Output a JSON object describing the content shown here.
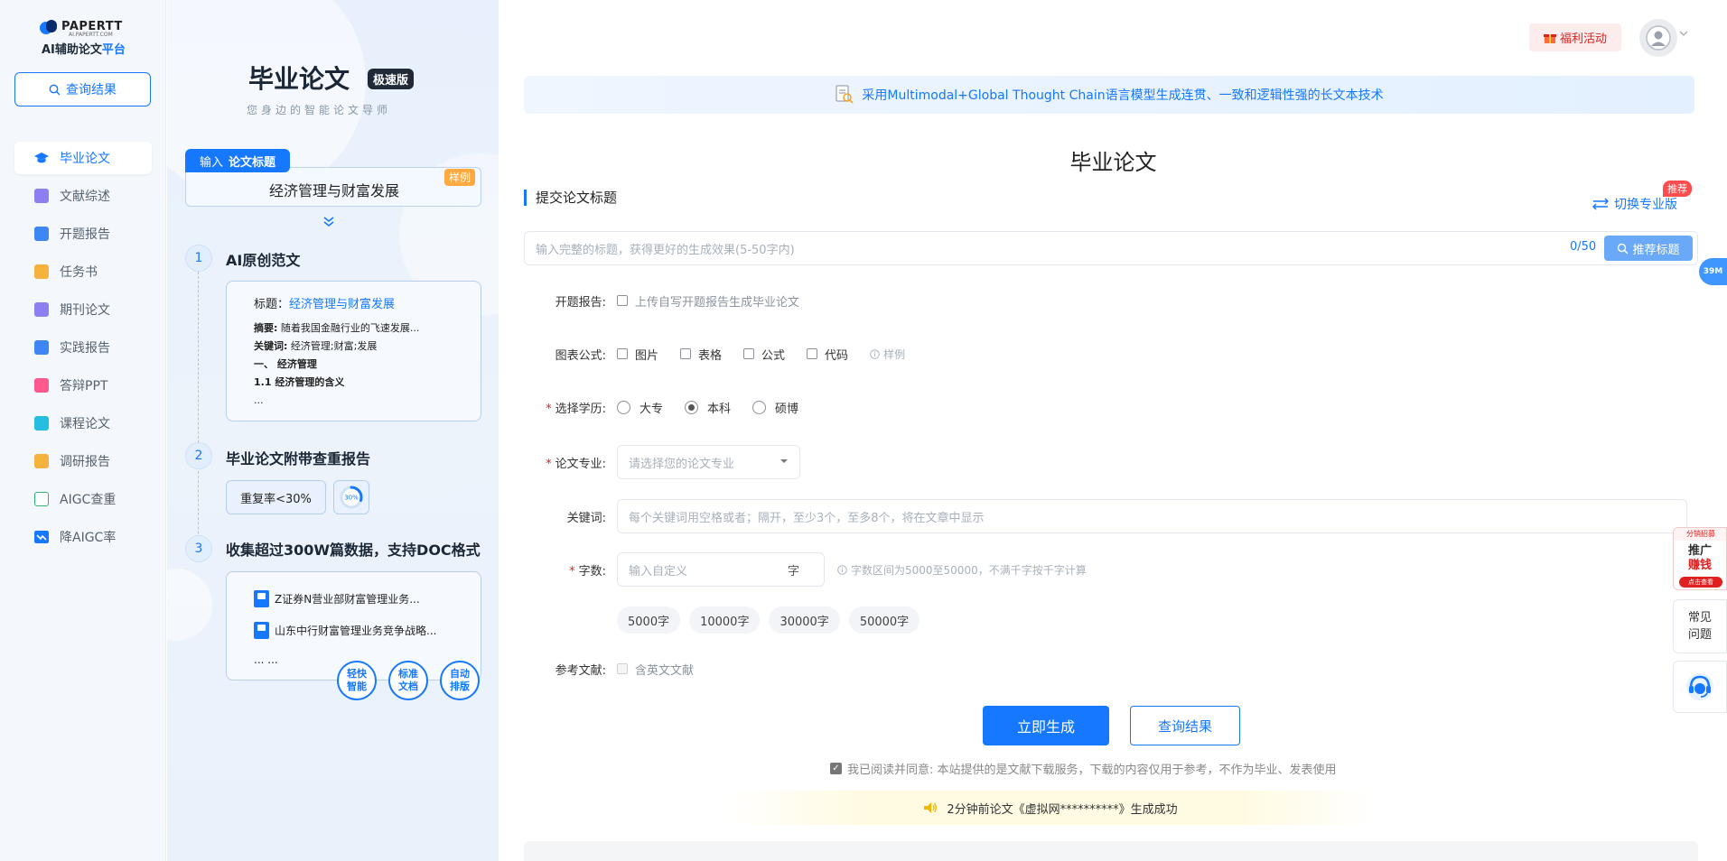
{
  "logo": {
    "brand": "PAPERTT",
    "domain": "AI.PAPERTT.COM",
    "tagline_main": "AI辅助论文",
    "tagline_accent": "平台"
  },
  "sidebar": {
    "query_button": "查询结果",
    "items": [
      {
        "label": "毕业论文",
        "icon": "graduation-cap-icon",
        "color": "#1677ff",
        "active": true
      },
      {
        "label": "文献综述",
        "icon": "document-list-icon",
        "color": "#7c6cf0"
      },
      {
        "label": "开题报告",
        "icon": "report-stack-icon",
        "color": "#1677ff"
      },
      {
        "label": "任务书",
        "icon": "task-icon",
        "color": "#f5a623"
      },
      {
        "label": "期刊论文",
        "icon": "journal-icon",
        "color": "#7c6cf0"
      },
      {
        "label": "实践报告",
        "icon": "practice-report-icon",
        "color": "#1677ff"
      },
      {
        "label": "答辩PPT",
        "icon": "ppt-icon",
        "color": "#ff4d8d"
      },
      {
        "label": "课程论文",
        "icon": "course-paper-icon",
        "color": "#13b5d6"
      },
      {
        "label": "调研报告",
        "icon": "clipboard-icon",
        "color": "#f5a623"
      },
      {
        "label": "AIGC查重",
        "icon": "aigc-check-icon",
        "color": "#2fb36d"
      },
      {
        "label": "降AIGC率",
        "icon": "trend-down-icon",
        "color": "#1677ff"
      }
    ]
  },
  "intro": {
    "title": "毕业论文",
    "badge": "极速版",
    "subtitle": "您身边的智能论文导师",
    "example_tab_prefix": "输入",
    "example_tab_label": "论文标题",
    "example_title": "经济管理与财富发展",
    "example_badge": "样例",
    "steps": [
      {
        "num": "1",
        "title": "AI原创范文"
      },
      {
        "num": "2",
        "title": "毕业论文附带查重报告"
      },
      {
        "num": "3",
        "title": "收集超过300W篇数据，支持DOC格式"
      }
    ],
    "sample": {
      "title_label": "标题：",
      "title_value": "经济管理与财富发展",
      "abstract_label": "摘要:",
      "abstract_value": "随着我国金融行业的飞速发展...",
      "keywords_label": "关键词:",
      "keywords_value": "经济管理;财富;发展",
      "heading1": "一、 经济管理",
      "heading2": "1.1 经济管理的含义",
      "more": "..."
    },
    "dup_rate": "重复率<30%",
    "ring_percent": "30%",
    "ring_value": 0.3,
    "references": [
      "Z证券N营业部财富管理业务...",
      "山东中行财富管理业务竞争战略..."
    ],
    "references_more": "... ...",
    "features": [
      {
        "line1": "轻快",
        "line2": "智能"
      },
      {
        "line1": "标准",
        "line2": "文档"
      },
      {
        "line1": "自动",
        "line2": "排版"
      }
    ]
  },
  "header": {
    "promo_button": "福利活动",
    "banner": "采用Multimodal+Global Thought Chain语言模型生成连贯、一致和逻辑性强的长文本技术"
  },
  "form": {
    "page_title": "毕业论文",
    "section_title": "提交论文标题",
    "switch_label": "切换专业版",
    "recommend_tag": "推荐",
    "title_placeholder": "输入完整的标题，获得更好的生成效果(5-50字内)",
    "title_count": "0/50",
    "recommend_button": "推荐标题",
    "proposal_label": "开题报告:",
    "proposal_option": "上传自写开题报告生成毕业论文",
    "charts_label": "图表公式:",
    "chart_options": [
      "图片",
      "表格",
      "公式",
      "代码"
    ],
    "sample_hint": "样例",
    "degree_label": "选择学历:",
    "degree_options": [
      "大专",
      "本科",
      "硕博"
    ],
    "degree_selected": "本科",
    "major_label": "论文专业:",
    "major_placeholder": "请选择您的论文专业",
    "keywords_label": "关键词:",
    "keywords_placeholder": "每个关键词用空格或者；隔开，至少3个，至多8个，将在文章中显示",
    "wordcount_label": "字数:",
    "wordcount_placeholder": "输入自定义",
    "wordcount_unit": "字",
    "wordcount_hint": "字数区间为5000至50000，不满千字按千字计算",
    "wordcount_chips": [
      "5000字",
      "10000字",
      "30000字",
      "50000字"
    ],
    "refs_label": "参考文献:",
    "refs_option": "含英文文献",
    "generate_button": "立即生成",
    "query_button": "查询结果",
    "agreement": "我已阅读并同意: 本站提供的是文献下载服务，下载的内容仅用于参考，不作为毕业、发表使用",
    "notice": "2分钟前论文《虚拟网**********》生成成功"
  },
  "floats": {
    "counter": "39M",
    "promo_top": "分销招募",
    "promo_line1": "推广",
    "promo_line2": "赚钱",
    "promo_cta": "点击查看",
    "faq_line1": "常见",
    "faq_line2": "问题"
  }
}
